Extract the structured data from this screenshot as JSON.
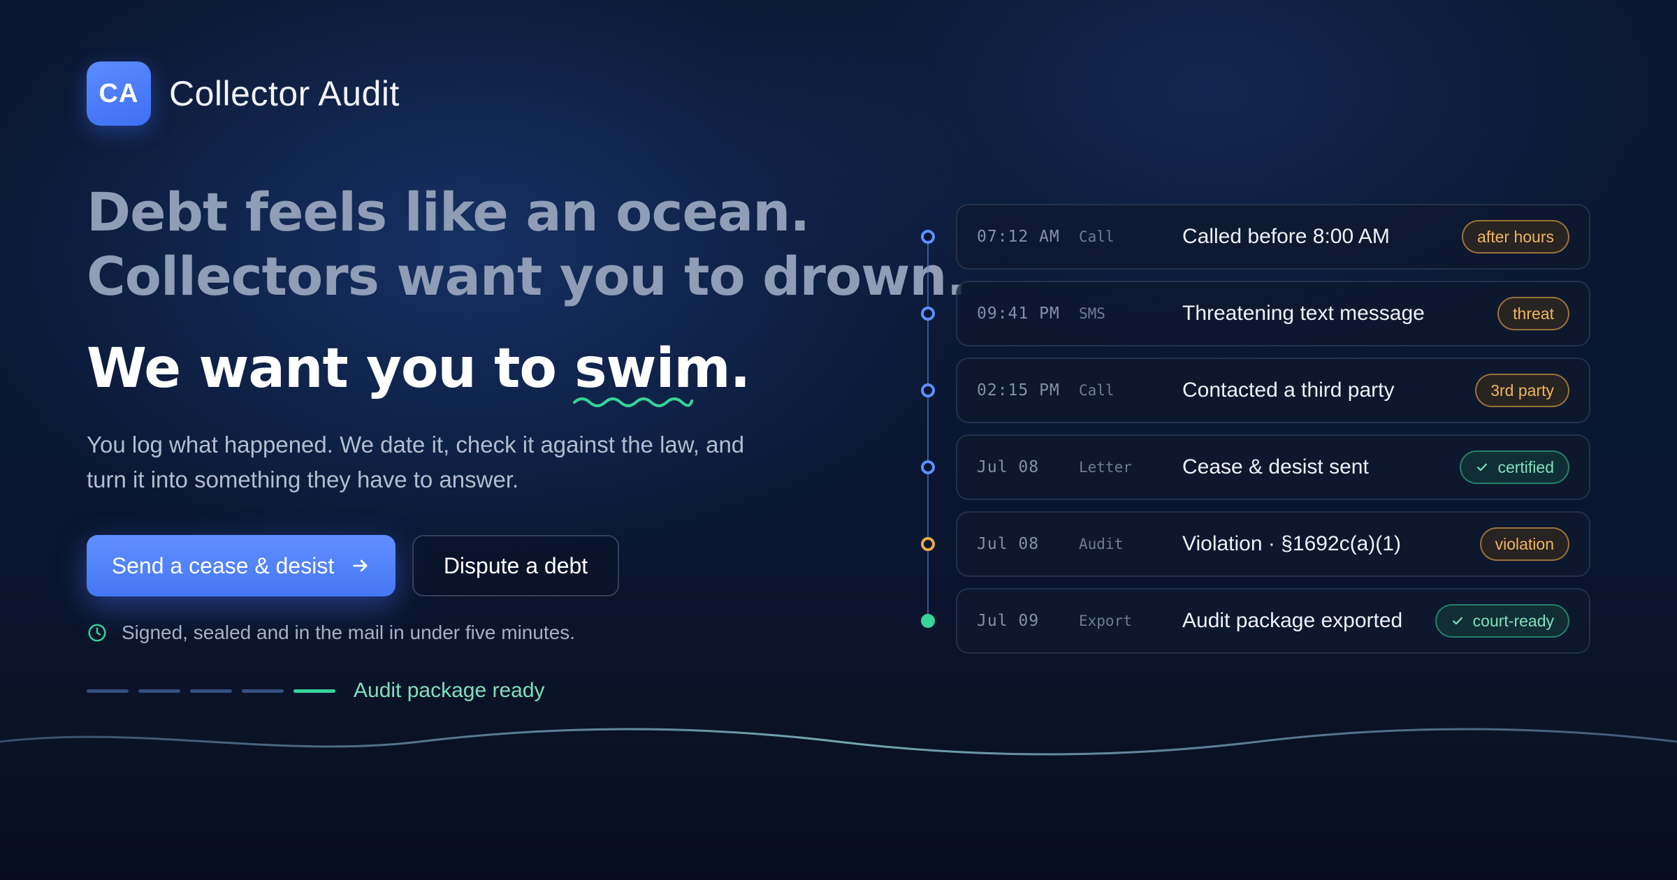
{
  "brand": {
    "logo_text": "CA",
    "name": "Collector Audit"
  },
  "hero": {
    "line1": "Debt feels like an ocean.",
    "line2": "Collectors want you to drown.",
    "swim_prefix": "We want you to ",
    "swim_word": "swim",
    "swim_suffix": ".",
    "description": "You log what happened. We date it, check it against the law, and turn it into something they have to answer."
  },
  "actions": {
    "primary_label": "Send a cease & desist",
    "secondary_label": "Dispute a debt",
    "note": "Signed, sealed and in the mail in under five minutes."
  },
  "progress": {
    "segments_total": 5,
    "segments_done": 1,
    "label": "Audit package ready"
  },
  "timeline": [
    {
      "time": "07:12 AM",
      "kind": "Call",
      "title": "Called before 8:00 AM",
      "badge": "after hours",
      "badge_type": "warn",
      "dot": "blue"
    },
    {
      "time": "09:41 PM",
      "kind": "SMS",
      "title": "Threatening text message",
      "badge": "threat",
      "badge_type": "warn",
      "dot": "blue"
    },
    {
      "time": "02:15 PM",
      "kind": "Call",
      "title": "Contacted a third party",
      "badge": "3rd party",
      "badge_type": "warn",
      "dot": "blue"
    },
    {
      "time": "Jul 08",
      "kind": "Letter",
      "title": "Cease & desist sent",
      "badge": "certified",
      "badge_type": "ok",
      "dot": "blue"
    },
    {
      "time": "Jul 08",
      "kind": "Audit",
      "title": "Violation · §1692c(a)(1)",
      "badge": "violation",
      "badge_type": "warn",
      "dot": "amber"
    },
    {
      "time": "Jul 09",
      "kind": "Export",
      "title": "Audit package exported",
      "badge": "court-ready",
      "badge_type": "ok",
      "dot": "green"
    }
  ],
  "colors": {
    "accent": "#4f7ffb",
    "success": "#37d39a",
    "warning": "#e9a94a",
    "background": "#0b1630"
  },
  "icons": {
    "primary_action": "arrow-right-icon",
    "note": "clock-icon",
    "ok_badge": "check-icon"
  }
}
